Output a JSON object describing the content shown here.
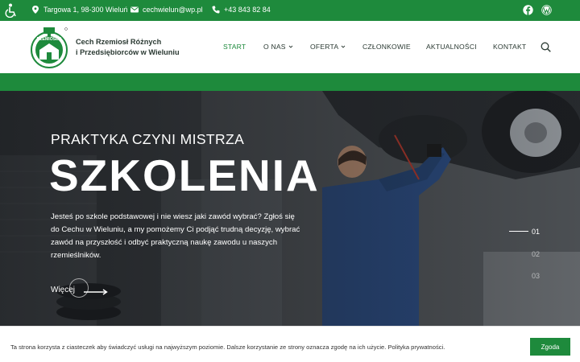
{
  "topbar": {
    "address": "Targowa 1, 98-300 Wieluń",
    "email": "cechwielun@wp.pl",
    "phone": "+43 843 82 84",
    "icons": [
      "accessibility-icon",
      "location-pin-icon",
      "mail-icon",
      "phone-icon",
      "facebook-icon",
      "wordpress-icon"
    ]
  },
  "header": {
    "logo_text": "RZEMIOSŁO",
    "brand_line1": "Cech Rzemiosł Różnych",
    "brand_line2": "i Przedsiębiorców w Wieluniu",
    "nav": [
      "START",
      "O NAS",
      "OFERTA",
      "CZŁONKOWIE",
      "AKTUALNOŚCI",
      "KONTAKT"
    ],
    "active_nav": "START"
  },
  "hero": {
    "kicker": "PRAKTYKA CZYNI MISTRZA",
    "headline": "SZKOLENIA",
    "description": "Jesteś po szkole podstawowej i nie wiesz jaki zawód wybrać? Zgłoś się do Cechu w Wieluniu, a my pomożemy Ci podjąć trudną decyzję, wybrać zawód na przyszłość i odbyć praktyczną naukę zawodu u naszych rzemieślników.",
    "more_label": "Więcej",
    "slides": [
      "01",
      "02",
      "03"
    ],
    "active_slide": "01"
  },
  "cookie": {
    "text": "Ta strona korzysta z ciasteczek aby świadczyć usługi na najwyższym poziomie. Dalsze korzystanie ze strony oznacza zgodę na ich użycie. Polityka prywatności.",
    "accept_label": "Zgoda"
  },
  "colors": {
    "brand_green": "#1e8a3c",
    "text_dark": "#2b3a33",
    "white": "#ffffff"
  }
}
